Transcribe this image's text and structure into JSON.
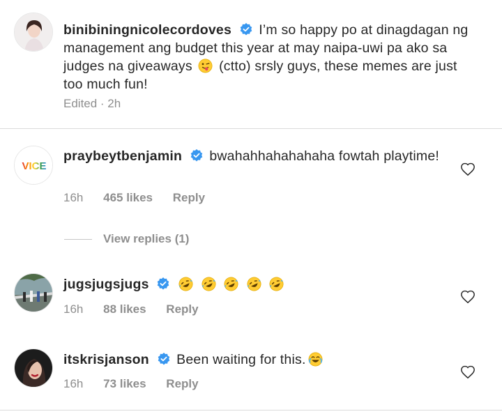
{
  "post": {
    "username": "binibiningnicolecordoves",
    "text_before_emoji": "I’m so happy po at dinagdagan ng management ang budget this year at may naipa-uwi pa ako sa judges na giveaways",
    "text_after_emoji": "(ctto) srsly guys, these memes are just too much fun!",
    "emoji": "winking-face-with-tongue-emoji",
    "status": "Edited · 2h"
  },
  "comments": [
    {
      "username": "praybeytbenjamin",
      "avatar_text": "VICE",
      "text": "bwahahhahahahaha fowtah playtime!",
      "time": "16h",
      "likes": "465 likes",
      "reply": "Reply",
      "view_replies": "View replies (1)"
    },
    {
      "username": "jugsjugsjugs",
      "emoji": "rolling-on-the-floor-laughing-emoji",
      "emoji_count": 5,
      "time": "16h",
      "likes": "88 likes",
      "reply": "Reply"
    },
    {
      "username": "itskrisjanson",
      "text": "Been waiting for this.",
      "emoji": "face-with-tears-of-joy-emoji",
      "time": "16h",
      "likes": "73 likes",
      "reply": "Reply"
    }
  ],
  "colors": {
    "verified": "#3897f0",
    "meta_text": "#8e8e8e",
    "divider": "#dbdbdb",
    "primary_text": "#262626"
  }
}
